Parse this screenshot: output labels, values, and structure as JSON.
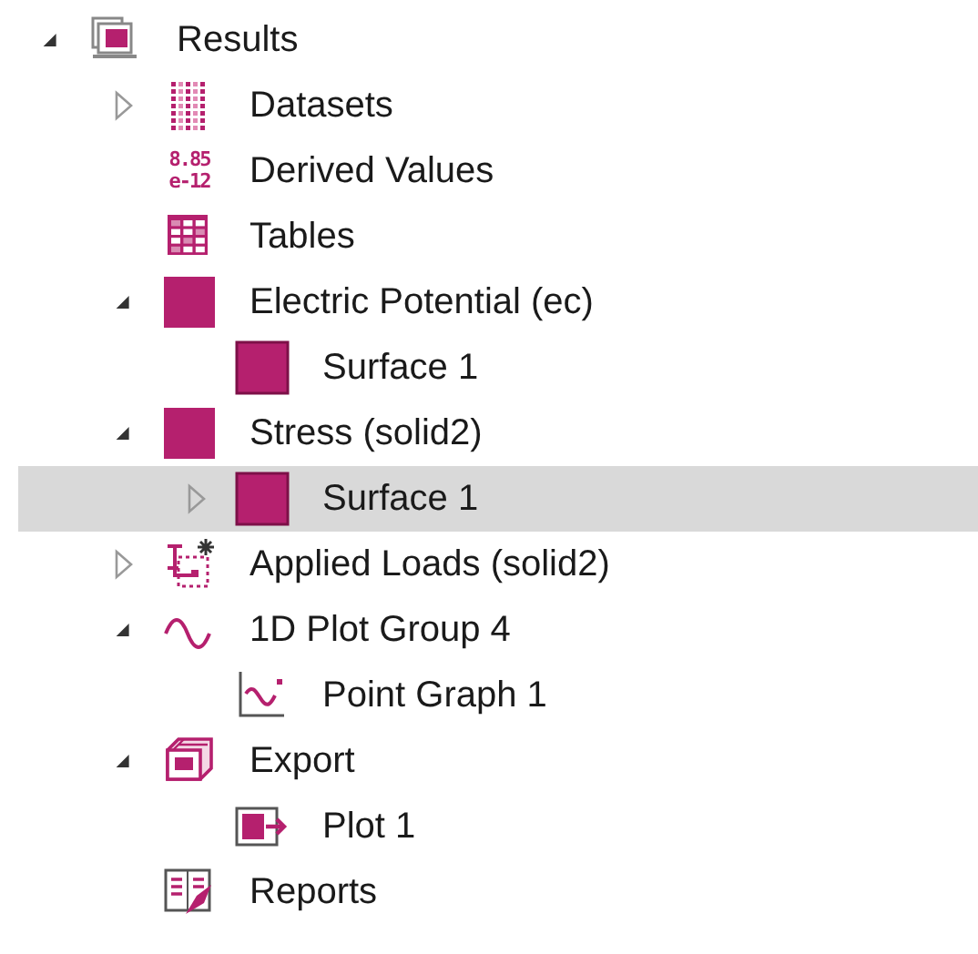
{
  "tree": [
    {
      "label": "Results",
      "kind": "results",
      "expanded": true,
      "selected": false,
      "children": [
        {
          "label": "Datasets",
          "kind": "datasets",
          "expanded": false,
          "selected": false
        },
        {
          "label": "Derived Values",
          "kind": "derived",
          "icon_text": [
            "8.85",
            "e-12"
          ],
          "selected": false
        },
        {
          "label": "Tables",
          "kind": "table",
          "selected": false
        },
        {
          "label": "Electric Potential (ec)",
          "kind": "plotgroup",
          "expanded": true,
          "selected": false,
          "children": [
            {
              "label": "Surface 1",
              "kind": "surface",
              "selected": false
            }
          ]
        },
        {
          "label": "Stress (solid2)",
          "kind": "plotgroup",
          "expanded": true,
          "selected": false,
          "children": [
            {
              "label": "Surface 1",
              "kind": "surface",
              "expanded": false,
              "selected": true
            }
          ]
        },
        {
          "label": "Applied Loads (solid2)",
          "kind": "loads",
          "expanded": false,
          "selected": false
        },
        {
          "label": "1D Plot Group 4",
          "kind": "wave",
          "expanded": true,
          "selected": false,
          "children": [
            {
              "label": "Point Graph 1",
              "kind": "graph",
              "selected": false
            }
          ]
        },
        {
          "label": "Export",
          "kind": "export",
          "expanded": true,
          "selected": false,
          "children": [
            {
              "label": "Plot 1",
              "kind": "exportplot",
              "selected": false
            }
          ]
        },
        {
          "label": "Reports",
          "kind": "reports",
          "selected": false
        }
      ]
    }
  ]
}
